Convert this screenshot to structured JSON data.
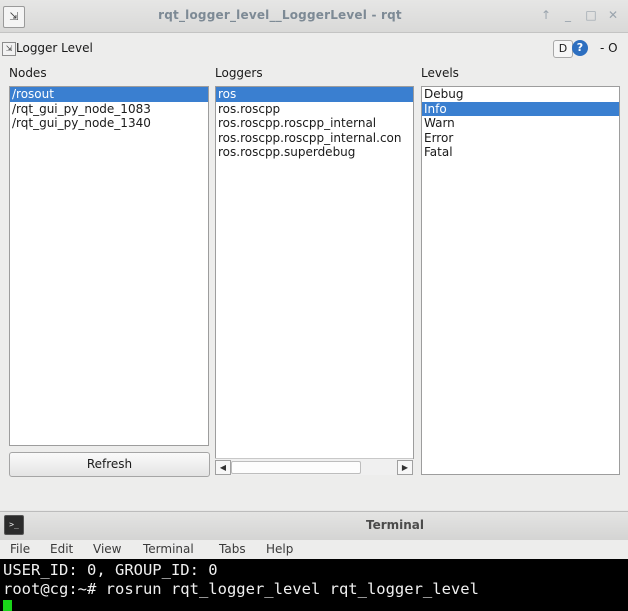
{
  "window": {
    "title": "rqt_logger_level__LoggerLevel - rqt",
    "controls": {
      "up": "↑",
      "minimize": "_",
      "maximize": "□",
      "close": "✕"
    }
  },
  "plugin": {
    "title": "Logger Level",
    "d_label": "D",
    "help_glyph": "?",
    "extra": "- O"
  },
  "columns": {
    "nodes": {
      "label": "Nodes",
      "items": [
        "/rosout",
        "/rqt_gui_py_node_1083",
        "/rqt_gui_py_node_1340"
      ],
      "selected": "/rosout"
    },
    "loggers": {
      "label": "Loggers",
      "items": [
        "ros",
        "ros.roscpp",
        "ros.roscpp.roscpp_internal",
        "ros.roscpp.roscpp_internal.con",
        "ros.roscpp.superdebug"
      ],
      "selected": "ros"
    },
    "levels": {
      "label": "Levels",
      "items": [
        "Debug",
        "Info",
        "Warn",
        "Error",
        "Fatal"
      ],
      "selected": "Info"
    }
  },
  "refresh_label": "Refresh",
  "scroll_arrows": {
    "left": "◀",
    "right": "▶"
  },
  "terminal": {
    "title": "Terminal",
    "icon_text": ">_",
    "menu": [
      "File",
      "Edit",
      "View",
      "Terminal",
      "Tabs",
      "Help"
    ],
    "lines": [
      "USER_ID: 0, GROUP_ID: 0",
      "root@cg:~# rosrun rqt_logger_level rqt_logger_level"
    ]
  },
  "colors": {
    "selection": "#3a7fd0",
    "terminal_bg": "#000000",
    "cursor": "#19d419"
  }
}
